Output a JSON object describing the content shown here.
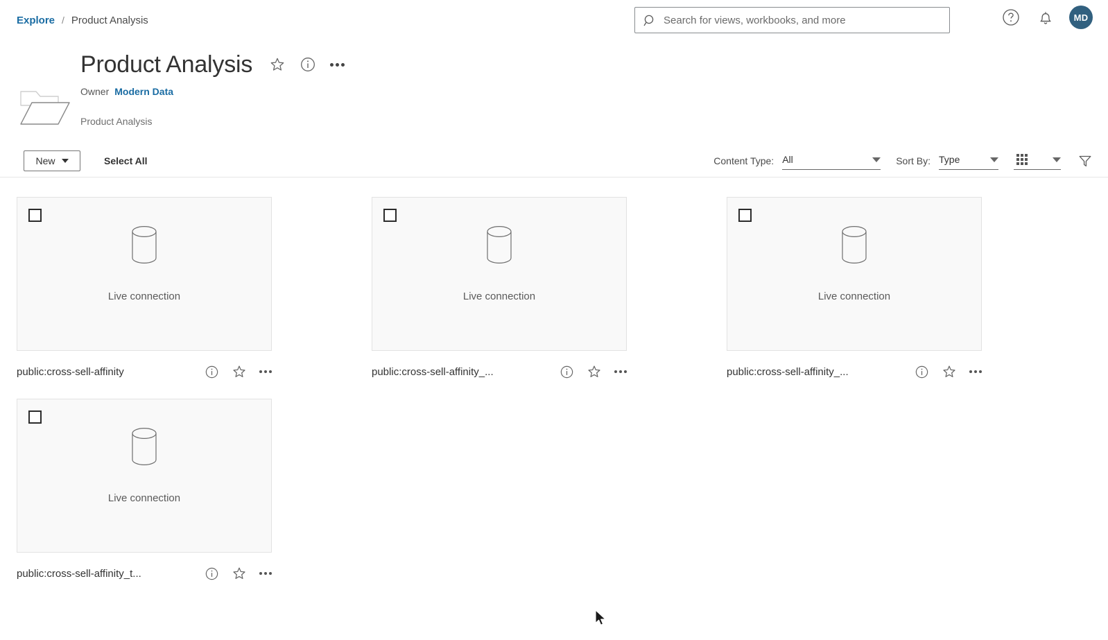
{
  "breadcrumb": {
    "root": "Explore",
    "separator": "/",
    "current": "Product Analysis"
  },
  "search": {
    "placeholder": "Search for views, workbooks, and more",
    "value": "",
    "icon": "search-icon"
  },
  "topbar": {
    "help_icon": "help-circle-icon",
    "notifications_icon": "bell-icon",
    "avatar_initials": "MD"
  },
  "header": {
    "icon": "folder-icon",
    "title": "Product Analysis",
    "favorite_icon": "star-icon",
    "info_icon": "info-circle-icon",
    "more_icon": "ellipsis-icon",
    "owner_label": "Owner",
    "owner_name": "Modern Data",
    "description": "Product Analysis"
  },
  "toolbar": {
    "new_label": "New",
    "select_all_label": "Select All",
    "content_type_label": "Content Type:",
    "content_type_value": "All",
    "sort_by_label": "Sort By:",
    "sort_by_value": "Type",
    "grid_view_icon": "grid-view-icon",
    "filter_icon": "funnel-filter-icon"
  },
  "colors": {
    "link": "#1a6ca3",
    "avatar_bg": "#31607f",
    "thumb_bg": "#f9f9f9",
    "text": "#333333"
  },
  "cards": [
    {
      "checkbox_checked": false,
      "thumb_icon": "database-cylinder-icon",
      "thumb_label": "Live connection",
      "title": "public:cross-sell-affinity",
      "info_icon": "info-circle-icon",
      "favorite_icon": "star-icon",
      "more_icon": "ellipsis-icon"
    },
    {
      "checkbox_checked": false,
      "thumb_icon": "database-cylinder-icon",
      "thumb_label": "Live connection",
      "title": "public:cross-sell-affinity_...",
      "info_icon": "info-circle-icon",
      "favorite_icon": "star-icon",
      "more_icon": "ellipsis-icon"
    },
    {
      "checkbox_checked": false,
      "thumb_icon": "database-cylinder-icon",
      "thumb_label": "Live connection",
      "title": "public:cross-sell-affinity_...",
      "info_icon": "info-circle-icon",
      "favorite_icon": "star-icon",
      "more_icon": "ellipsis-icon"
    },
    {
      "checkbox_checked": false,
      "thumb_icon": "database-cylinder-icon",
      "thumb_label": "Live connection",
      "title": "public:cross-sell-affinity_t...",
      "info_icon": "info-circle-icon",
      "favorite_icon": "star-icon",
      "more_icon": "ellipsis-icon"
    }
  ]
}
